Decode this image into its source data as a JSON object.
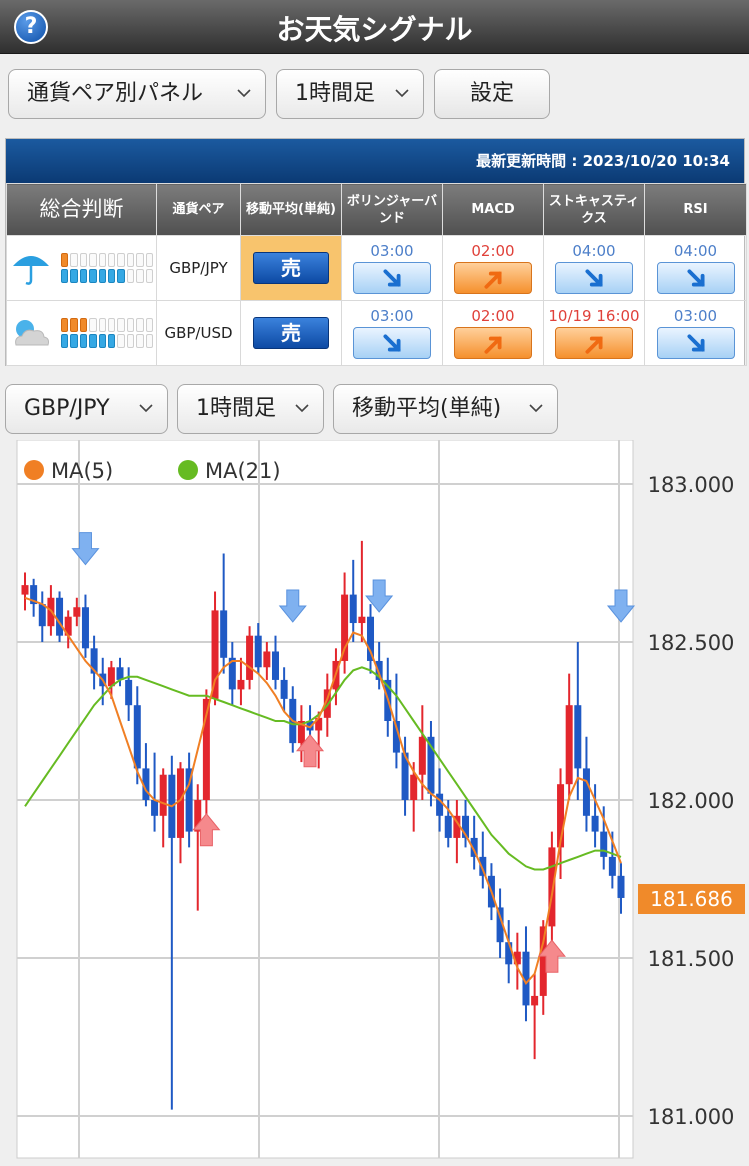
{
  "header": {
    "title": "お天気シグナル",
    "help_icon": "?"
  },
  "controls": {
    "panel_select": "通貨ペア別パネル",
    "timeframe_select": "1時間足",
    "settings_button": "設定"
  },
  "panel": {
    "updated": "最新更新時間 : 2023/10/20 10:34",
    "columns": [
      "総合判断",
      "通貨ペア",
      "移動平均(単純)",
      "ボリンジャーバンド",
      "MACD",
      "ストキャスティクス",
      "RSI"
    ],
    "rows": [
      {
        "weather_icon": "umbrella-icon",
        "orange_bars": 1,
        "blue_bars": 7,
        "pair": "GBP/JPY",
        "ma": "売",
        "signals": [
          {
            "time": "03:00",
            "dir": "down"
          },
          {
            "time": "02:00",
            "dir": "up"
          },
          {
            "time": "04:00",
            "dir": "down"
          },
          {
            "time": "04:00",
            "dir": "down"
          }
        ]
      },
      {
        "weather_icon": "cloudy-icon",
        "orange_bars": 3,
        "blue_bars": 6,
        "pair": "GBP/USD",
        "ma": "売",
        "signals": [
          {
            "time": "03:00",
            "dir": "down"
          },
          {
            "time": "02:00",
            "dir": "up"
          },
          {
            "time": "10/19 16:00",
            "dir": "up"
          },
          {
            "time": "03:00",
            "dir": "down"
          }
        ]
      }
    ]
  },
  "chart_controls": {
    "pair_select": "GBP/JPY",
    "timeframe_select": "1時間足",
    "indicator_select": "移動平均(単純)"
  },
  "chart_data": {
    "type": "candlestick",
    "legend": [
      {
        "name": "MA(5)",
        "color": "#f07f24"
      },
      {
        "name": "MA(21)",
        "color": "#66bb22"
      }
    ],
    "y_ticks": [
      "183.000",
      "182.500",
      "182.000",
      "181.500",
      "181.000"
    ],
    "ylim": [
      181.0,
      183.0
    ],
    "current_price": "181.686",
    "ohlc": [
      [
        182.65,
        182.72,
        182.6,
        182.68
      ],
      [
        182.68,
        182.7,
        182.58,
        182.62
      ],
      [
        182.62,
        182.66,
        182.5,
        182.55
      ],
      [
        182.55,
        182.68,
        182.52,
        182.64
      ],
      [
        182.64,
        182.66,
        182.5,
        182.52
      ],
      [
        182.52,
        182.6,
        182.48,
        182.58
      ],
      [
        182.58,
        182.64,
        182.55,
        182.61
      ],
      [
        182.61,
        182.65,
        182.45,
        182.48
      ],
      [
        182.48,
        182.52,
        182.35,
        182.4
      ],
      [
        182.4,
        182.45,
        182.3,
        182.36
      ],
      [
        182.36,
        182.44,
        182.32,
        182.42
      ],
      [
        182.42,
        182.45,
        182.36,
        182.38
      ],
      [
        182.38,
        182.42,
        182.25,
        182.3
      ],
      [
        182.3,
        182.36,
        182.05,
        182.1
      ],
      [
        182.1,
        182.18,
        181.98,
        182.0
      ],
      [
        182.0,
        182.15,
        181.9,
        181.95
      ],
      [
        181.95,
        182.1,
        181.85,
        182.08
      ],
      [
        182.08,
        182.14,
        181.02,
        181.88
      ],
      [
        181.88,
        182.12,
        181.8,
        182.1
      ],
      [
        182.1,
        182.15,
        181.85,
        181.9
      ],
      [
        181.9,
        182.05,
        181.65,
        182.0
      ],
      [
        182.0,
        182.35,
        181.95,
        182.32
      ],
      [
        182.32,
        182.66,
        182.3,
        182.6
      ],
      [
        182.6,
        182.78,
        182.4,
        182.45
      ],
      [
        182.45,
        182.5,
        182.3,
        182.35
      ],
      [
        182.35,
        182.45,
        182.3,
        182.38
      ],
      [
        182.38,
        182.55,
        182.35,
        182.52
      ],
      [
        182.52,
        182.56,
        182.4,
        182.42
      ],
      [
        182.42,
        182.5,
        182.38,
        182.47
      ],
      [
        182.47,
        182.52,
        182.35,
        182.38
      ],
      [
        182.38,
        182.42,
        182.28,
        182.32
      ],
      [
        182.32,
        182.36,
        182.15,
        182.18
      ],
      [
        182.18,
        182.3,
        182.12,
        182.25
      ],
      [
        182.25,
        182.3,
        182.2,
        182.22
      ],
      [
        182.22,
        182.28,
        182.1,
        182.26
      ],
      [
        182.26,
        182.4,
        182.2,
        182.35
      ],
      [
        182.35,
        182.48,
        182.3,
        182.44
      ],
      [
        182.44,
        182.72,
        182.4,
        182.65
      ],
      [
        182.65,
        182.76,
        182.5,
        182.56
      ],
      [
        182.56,
        182.82,
        182.5,
        182.58
      ],
      [
        182.58,
        182.62,
        182.4,
        182.44
      ],
      [
        182.44,
        182.5,
        182.35,
        182.38
      ],
      [
        182.38,
        182.45,
        182.2,
        182.25
      ],
      [
        182.25,
        182.4,
        182.1,
        182.15
      ],
      [
        182.15,
        182.2,
        181.95,
        182.0
      ],
      [
        182.0,
        182.12,
        181.9,
        182.08
      ],
      [
        182.08,
        182.3,
        182.0,
        182.2
      ],
      [
        182.2,
        182.25,
        181.98,
        182.02
      ],
      [
        182.02,
        182.1,
        181.9,
        181.95
      ],
      [
        181.95,
        182.0,
        181.85,
        181.88
      ],
      [
        181.88,
        182.0,
        181.8,
        181.95
      ],
      [
        181.95,
        182.0,
        181.85,
        181.88
      ],
      [
        181.88,
        181.95,
        181.78,
        181.82
      ],
      [
        181.82,
        181.9,
        181.72,
        181.76
      ],
      [
        181.76,
        181.8,
        181.62,
        181.66
      ],
      [
        181.66,
        181.72,
        181.5,
        181.55
      ],
      [
        181.55,
        181.62,
        181.42,
        181.48
      ],
      [
        181.48,
        181.58,
        181.4,
        181.52
      ],
      [
        181.52,
        181.6,
        181.3,
        181.35
      ],
      [
        181.35,
        181.45,
        181.18,
        181.38
      ],
      [
        181.38,
        181.62,
        181.32,
        181.6
      ],
      [
        181.6,
        181.9,
        181.55,
        181.85
      ],
      [
        181.85,
        182.1,
        181.75,
        182.05
      ],
      [
        182.05,
        182.4,
        182.0,
        182.3
      ],
      [
        182.3,
        182.5,
        182.0,
        182.1
      ],
      [
        182.1,
        182.2,
        181.9,
        181.95
      ],
      [
        181.95,
        182.05,
        181.85,
        181.9
      ],
      [
        181.9,
        181.98,
        181.78,
        181.82
      ],
      [
        181.82,
        181.9,
        181.72,
        181.76
      ],
      [
        181.76,
        181.8,
        181.64,
        181.69
      ]
    ],
    "ma5": [
      182.64,
      182.63,
      182.62,
      182.6,
      182.56,
      182.52,
      182.48,
      182.44,
      182.41,
      182.38,
      182.33,
      182.25,
      182.17,
      182.09,
      182.03,
      182.0,
      181.99,
      181.98,
      182.0,
      182.05,
      182.16,
      182.27,
      182.38,
      182.42,
      182.44,
      182.44,
      182.42,
      182.4,
      182.37,
      182.33,
      182.28,
      182.25,
      182.24,
      182.23,
      182.26,
      182.32,
      182.4,
      182.48,
      182.53,
      182.52,
      182.47,
      182.4,
      182.32,
      182.23,
      182.14,
      182.09,
      182.05,
      182.02,
      182.0,
      181.97,
      181.93,
      181.89,
      181.84,
      181.78,
      181.71,
      181.63,
      181.55,
      181.47,
      181.42,
      181.45,
      181.55,
      181.7,
      181.87,
      182.01,
      182.07,
      182.06,
      182.0,
      181.94,
      181.87,
      181.8
    ],
    "ma21": [
      181.98,
      182.02,
      182.06,
      182.1,
      182.14,
      182.18,
      182.22,
      182.26,
      182.3,
      182.33,
      182.36,
      182.38,
      182.39,
      182.39,
      182.38,
      182.37,
      182.36,
      182.35,
      182.34,
      182.33,
      182.33,
      182.33,
      182.32,
      182.31,
      182.3,
      182.29,
      182.28,
      182.27,
      182.26,
      182.25,
      182.25,
      182.24,
      182.24,
      182.25,
      182.27,
      182.3,
      182.34,
      182.38,
      182.41,
      182.42,
      182.41,
      182.39,
      182.36,
      182.33,
      182.29,
      182.25,
      182.21,
      182.17,
      182.13,
      182.09,
      182.05,
      182.01,
      181.97,
      181.93,
      181.89,
      181.86,
      181.83,
      181.81,
      181.79,
      181.78,
      181.78,
      181.79,
      181.8,
      181.81,
      181.82,
      181.83,
      181.84,
      181.84,
      181.83,
      181.82
    ],
    "signals": [
      {
        "index": 7,
        "type": "sell"
      },
      {
        "index": 21,
        "type": "buy"
      },
      {
        "index": 31,
        "type": "sell"
      },
      {
        "index": 33,
        "type": "buy"
      },
      {
        "index": 41,
        "type": "sell"
      },
      {
        "index": 61,
        "type": "buy"
      },
      {
        "index": 69,
        "type": "sell"
      }
    ]
  }
}
